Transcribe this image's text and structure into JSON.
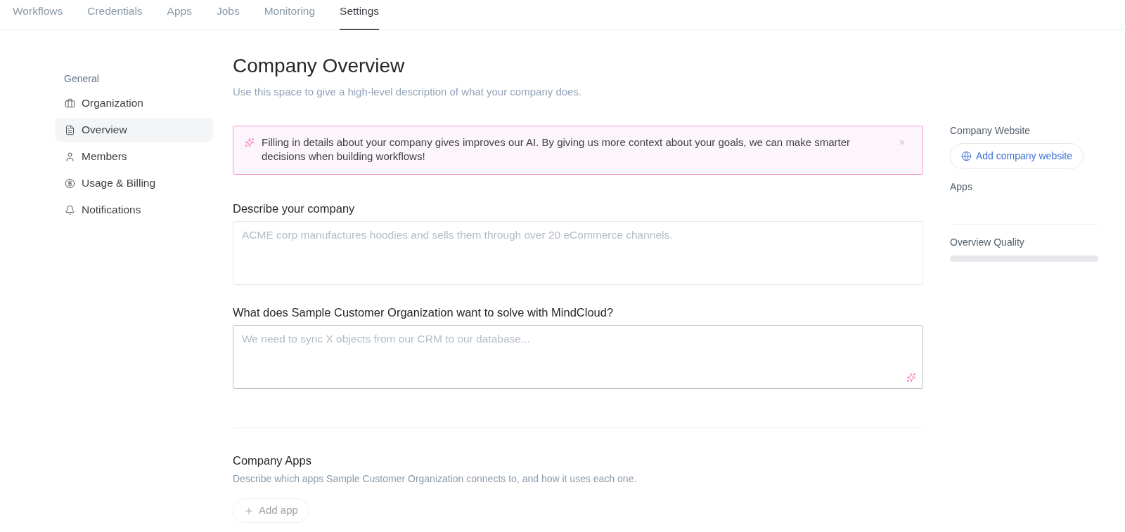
{
  "top_nav": {
    "tabs": [
      {
        "label": "Workflows",
        "selected": false
      },
      {
        "label": "Credentials",
        "selected": false
      },
      {
        "label": "Apps",
        "selected": false
      },
      {
        "label": "Jobs",
        "selected": false
      },
      {
        "label": "Monitoring",
        "selected": false
      },
      {
        "label": "Settings",
        "selected": true
      }
    ]
  },
  "sidebar": {
    "section": "General",
    "items": [
      {
        "label": "Organization",
        "selected": false
      },
      {
        "label": "Overview",
        "selected": true
      },
      {
        "label": "Members",
        "selected": false
      },
      {
        "label": "Usage & Billing",
        "selected": false
      },
      {
        "label": "Notifications",
        "selected": false
      }
    ]
  },
  "page": {
    "title": "Company Overview",
    "subtitle": "Use this space to give a high-level description of what your company does."
  },
  "notice": {
    "text": "Filling in details about your company gives improves our AI. By giving us more context about your goals, we can make smarter decisions when building workflows!"
  },
  "fields": [
    {
      "label": "Describe your company",
      "placeholder": "ACME corp manufactures hoodies and sells them through over 20 eCommerce channels.",
      "focused": false,
      "ai_assist": false
    },
    {
      "label": "What does Sample Customer Organization want to solve with MindCloud?",
      "placeholder": "We need to sync X objects from our CRM to our database...",
      "focused": true,
      "ai_assist": true
    }
  ],
  "company_apps": {
    "title": "Company Apps",
    "description": "Describe which apps Sample Customer Organization connects to, and how it uses each one.",
    "add_button": "Add app"
  },
  "side_panel": {
    "website": {
      "label": "Company Website",
      "button": "Add company website"
    },
    "apps": {
      "label": "Apps"
    },
    "quality": {
      "label": "Overview Quality"
    }
  }
}
